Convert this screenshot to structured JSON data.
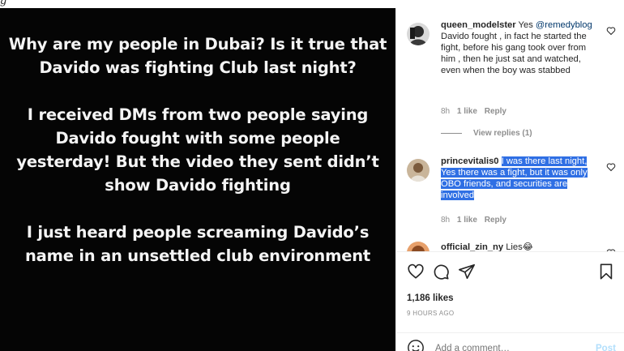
{
  "top_glyph": "g",
  "post": {
    "story_paragraphs": [
      "Why are my people in Dubai? Is it true that Davido was fighting Club last night?",
      "I received DMs from two people saying Davido fought with some people yesterday! But the video they sent didn’t show Davido fighting",
      "I just heard people screaming Davido’s name in an unsettled club environment"
    ]
  },
  "comments": [
    {
      "username": "queen_modelster",
      "text_prefix": "Yes ",
      "mention": "@remedyblog",
      "text": "Davido fought , in fact he started the fight, before his gang took over from him , then he just sat and watched, even when the boy was stabbed",
      "time": "8h",
      "likes": "1 like",
      "reply": "Reply",
      "view_replies": "View replies (1)"
    },
    {
      "username": "princevitalis0",
      "text": "I was there last night, Yes there was a fight, but it was only OBO friends, and securities are involved",
      "time": "8h",
      "likes": "1 like",
      "reply": "Reply"
    },
    {
      "username": "official_zin_ny",
      "text": "Lies😂"
    }
  ],
  "likes_count": "1,186 likes",
  "time_ago": "9 HOURS AGO",
  "comment_input": {
    "placeholder": "Add a comment…"
  },
  "post_button": "Post",
  "colors": {
    "accent_link": "#00376b",
    "selection": "#2f6fe4",
    "muted": "#8e8e8e",
    "post_disabled": "#b2dffc"
  }
}
